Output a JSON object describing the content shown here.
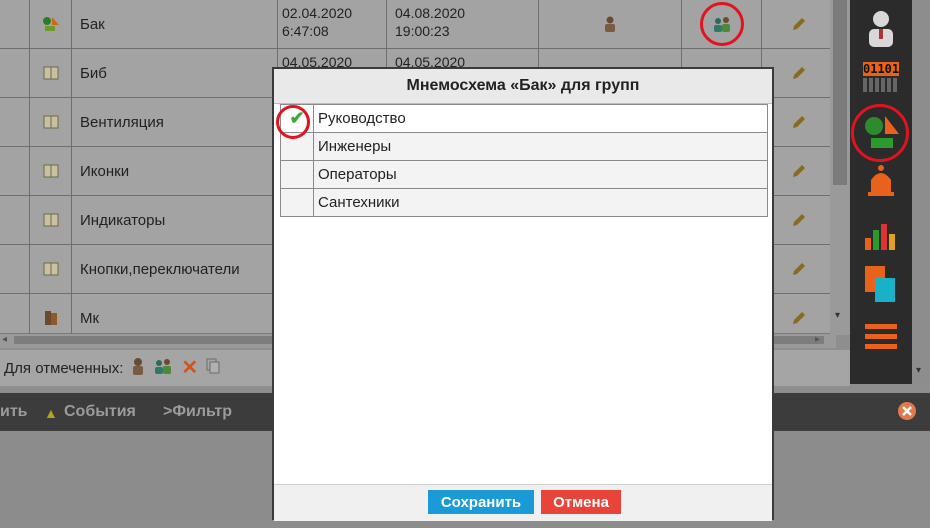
{
  "table": {
    "rows": [
      {
        "icon": "shapes-icon",
        "name": "Бак",
        "created_date": "02.04.2020",
        "created_time": "6:47:08",
        "modified_date": "04.08.2020",
        "modified_time": "19:00:23"
      },
      {
        "icon": "book-icon",
        "name": "Биб",
        "created_date": "04.05.2020",
        "created_time": "",
        "modified_date": "04.05.2020",
        "modified_time": ""
      },
      {
        "icon": "book-icon",
        "name": "Вентиляция"
      },
      {
        "icon": "book-icon",
        "name": "Иконки"
      },
      {
        "icon": "book-icon",
        "name": "Индикаторы"
      },
      {
        "icon": "book-icon",
        "name": "Кнопки,переключатели"
      },
      {
        "icon": "books-icon",
        "name": "Мк"
      }
    ]
  },
  "bulk_bar": {
    "label": "Для отмеченных:"
  },
  "bottom_bar": {
    "item_cut": "ить",
    "events": "События",
    "filter": ">Фильтр"
  },
  "modal": {
    "title": "Мнемосхема «Бак» для групп",
    "groups": [
      {
        "label": "Руководство",
        "checked": true
      },
      {
        "label": "Инженеры",
        "checked": false
      },
      {
        "label": "Операторы",
        "checked": false
      },
      {
        "label": "Сантехники",
        "checked": false
      }
    ],
    "save_label": "Сохранить",
    "cancel_label": "Отмена"
  },
  "toolbar": {
    "binary_label": "01101"
  },
  "colors": {
    "save": "#1a9ad6",
    "cancel": "#e8443a",
    "highlight_ring": "#e0141e",
    "check": "#3aa83a",
    "toolbar_accent": "#e8621c"
  }
}
